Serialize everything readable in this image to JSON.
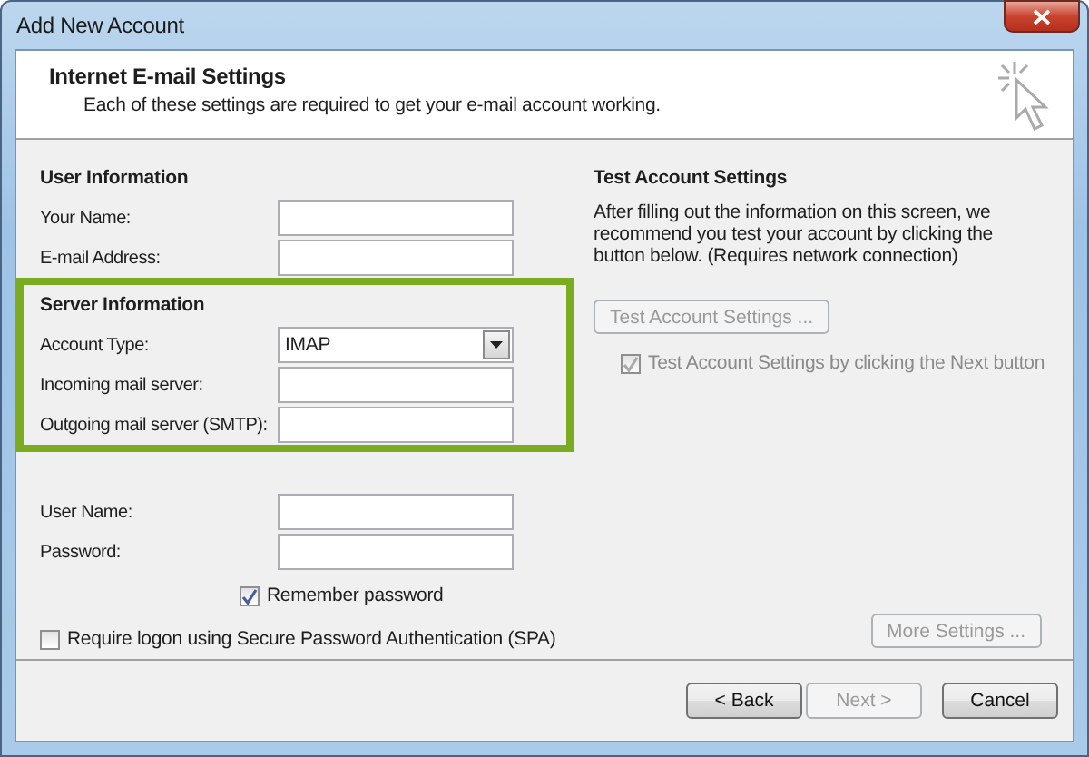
{
  "window": {
    "title": "Add New Account"
  },
  "header": {
    "title": "Internet E-mail Settings",
    "subtitle": "Each of these settings are required to get your e-mail account working."
  },
  "sections": [
    {
      "heading": "User Information",
      "highlighted": false,
      "fields": [
        {
          "label": "Your Name:",
          "kind": "text"
        },
        {
          "label": "E-mail Address:",
          "kind": "text"
        }
      ]
    },
    {
      "heading": "Server Information",
      "highlighted": true,
      "fields": [
        {
          "label": "Account Type:",
          "kind": "select",
          "value": "IMAP"
        },
        {
          "label": "Incoming mail server:",
          "kind": "text"
        },
        {
          "label": "Outgoing mail server (SMTP):",
          "kind": "text"
        }
      ]
    },
    {
      "highlighted": false,
      "fields": [
        {
          "label": "User Name:",
          "kind": "text"
        },
        {
          "label": "Password:",
          "kind": "password"
        }
      ]
    }
  ],
  "remember_password": {
    "label": "Remember password",
    "checked": true
  },
  "spa": {
    "label": "Require logon using Secure Password Authentication (SPA)",
    "checked": false
  },
  "test_settings": {
    "heading": "Test Account Settings",
    "description": "After filling out the information on this screen, we recommend you test your account by clicking the button below. (Requires network connection)",
    "button": {
      "label": "Test Account Settings ...",
      "disabled": true
    },
    "checkbox": {
      "label": "Test Account Settings by clicking the Next button",
      "checked": true,
      "disabled": true
    }
  },
  "more_settings": {
    "label": "More Settings ...",
    "disabled": true
  },
  "buttons": [
    {
      "label": "< Back",
      "disabled": false
    },
    {
      "label": "Next >",
      "disabled": true
    },
    {
      "label": "Cancel",
      "disabled": false
    }
  ]
}
